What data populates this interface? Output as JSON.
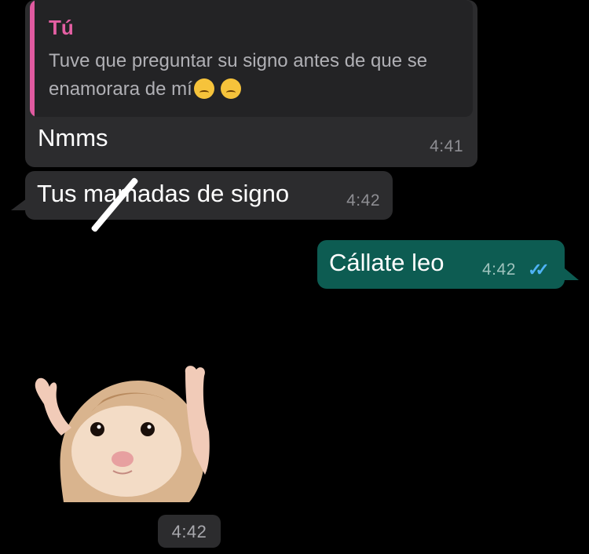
{
  "messages": [
    {
      "direction": "incoming",
      "reply": {
        "author": "Tú",
        "text": "Tuve que preguntar su signo antes de que se enamorara de mí",
        "emoji": [
          "crying-face",
          "weary-face"
        ]
      },
      "text": "Nmms",
      "time": "4:41"
    },
    {
      "direction": "incoming",
      "text": "Tus mamadas de signo",
      "time": "4:42"
    },
    {
      "direction": "outgoing",
      "text": "Cállate leo",
      "time": "4:42",
      "status": "read"
    },
    {
      "direction": "incoming",
      "type": "sticker",
      "sticker": "hamster-hands-up",
      "time": "4:42"
    }
  ],
  "colors": {
    "background": "#000000",
    "incoming_bubble": "#2c2c2e",
    "outgoing_bubble": "#0d5c52",
    "reply_accent": "#e05aa0",
    "read_ticks": "#4fb3f6"
  }
}
